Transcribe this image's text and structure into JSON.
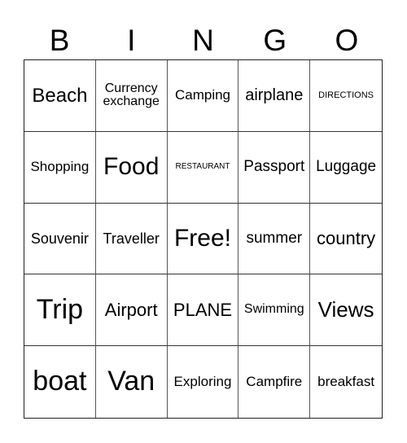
{
  "header": [
    "B",
    "I",
    "N",
    "G",
    "O"
  ],
  "cells": [
    "Beach",
    "Currency exchange",
    "Camping",
    "airplane",
    "DIRECTIONS",
    "Shopping",
    "Food",
    "RESTAURANT",
    "Passport",
    "Luggage",
    "Souvenir",
    "Traveller",
    "Free!",
    "summer",
    "country",
    "Trip",
    "Airport",
    "PLANE",
    "Swimming",
    "Views",
    "boat",
    "Van",
    "Exploring",
    "Campfire",
    "breakfast"
  ]
}
